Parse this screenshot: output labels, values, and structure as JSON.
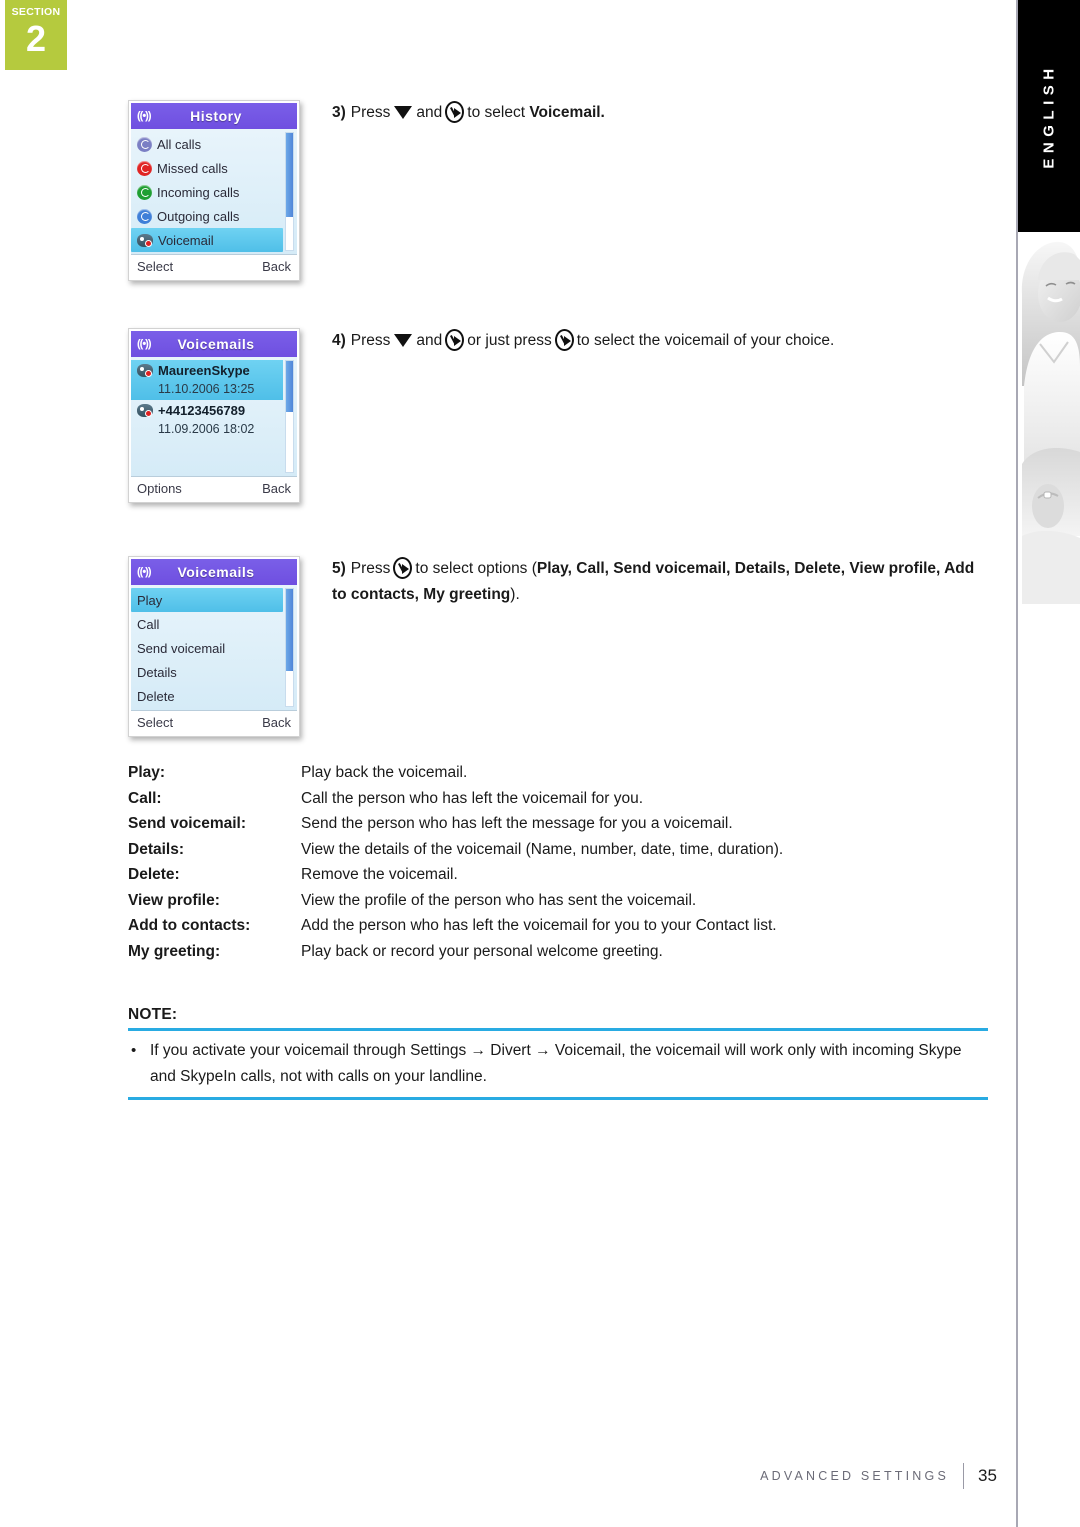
{
  "section": {
    "word": "SECTION",
    "number": "2"
  },
  "language_tab": {
    "label": "ENGLISH"
  },
  "steps": [
    {
      "number": "3)",
      "pre": "Press",
      "mid": "and",
      "post": "to select",
      "bold_tail": "Voicemail."
    },
    {
      "number": "4)",
      "pre": "Press",
      "mid": "and",
      "mid2": "or just press",
      "post": "to select the voicemail of your choice."
    },
    {
      "number": "5)",
      "pre": "Press",
      "post": "to select options (",
      "bold_options": "Play, Call, Send voicemail, Details, Delete, View profile, Add to contacts, My greeting",
      "tail": ")."
    }
  ],
  "screens": [
    {
      "title": "History",
      "left_softkey": "Select",
      "right_softkey": "Back",
      "items": [
        {
          "label": "All calls",
          "icon": "all-calls-icon",
          "color": "#7b7fc4",
          "selected": false
        },
        {
          "label": "Missed calls",
          "icon": "missed-calls-icon",
          "color": "#e02424",
          "selected": false
        },
        {
          "label": "Incoming calls",
          "icon": "incoming-calls-icon",
          "color": "#1f9f32",
          "selected": false
        },
        {
          "label": "Outgoing calls",
          "icon": "outgoing-calls-icon",
          "color": "#3f7fd8",
          "selected": false
        },
        {
          "label": "Voicemail",
          "icon": "voicemail-icon",
          "color": "#4a6d80",
          "selected": true
        }
      ]
    },
    {
      "title": "Voicemails",
      "left_softkey": "Options",
      "right_softkey": "Back",
      "entries": [
        {
          "name": "MaureenSkype",
          "date": "11.10.2006 13:25",
          "selected": true
        },
        {
          "name": "+44123456789",
          "date": "11.09.2006 18:02",
          "selected": false
        }
      ]
    },
    {
      "title": "Voicemails",
      "left_softkey": "Select",
      "right_softkey": "Back",
      "items": [
        {
          "label": "Play",
          "selected": true
        },
        {
          "label": "Call",
          "selected": false
        },
        {
          "label": "Send voicemail",
          "selected": false
        },
        {
          "label": "Details",
          "selected": false
        },
        {
          "label": "Delete",
          "selected": false
        }
      ]
    }
  ],
  "definitions": [
    {
      "term": "Play:",
      "desc": "Play back the voicemail."
    },
    {
      "term": "Call:",
      "desc": "Call the person who has left the voicemail for you."
    },
    {
      "term": "Send voicemail:",
      "desc": "Send the person who has left the message for you a voicemail."
    },
    {
      "term": "Details:",
      "desc": "View the details of the voicemail (Name, number, date, time, duration)."
    },
    {
      "term": "Delete:",
      "desc": "Remove the voicemail."
    },
    {
      "term": "View profile:",
      "desc": "View the profile of the person who has sent the voicemail."
    },
    {
      "term": "Add to contacts:",
      "desc": "Add the person who has left the voicemail for you to your Contact list."
    },
    {
      "term": "My greeting:",
      "desc": "Play back or record your personal welcome greeting."
    }
  ],
  "note": {
    "label": "NOTE:",
    "bullet": "•",
    "text": "If you activate your voicemail through Settings → Divert → Voicemail, the voicemail will work only with incoming Skype and SkypeIn calls, not with calls on your landline.",
    "rule_color": "#29abe2"
  },
  "footer": {
    "title": "ADVANCED SETTINGS",
    "page": "35"
  }
}
